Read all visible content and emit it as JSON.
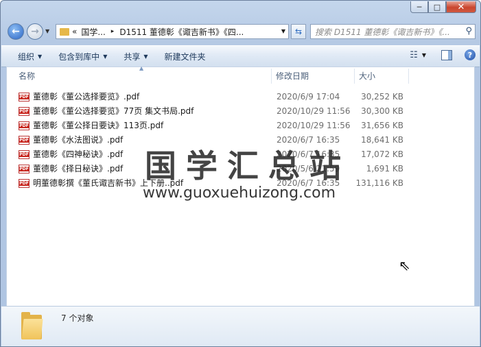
{
  "window": {
    "minimize_glyph": "─",
    "maximize_glyph": "□",
    "close_glyph": "✕"
  },
  "address": {
    "overflow": "«",
    "crumb_1": "国学...",
    "separator": "▸",
    "crumb_2": "D1511 董德彰《诹吉新书》《四..."
  },
  "search": {
    "placeholder": "搜索 D1511 董德彰《诹吉新书》《..."
  },
  "toolbar": {
    "organize": "组织",
    "include_in_library": "包含到库中",
    "share": "共享",
    "new_folder": "新建文件夹"
  },
  "columns": {
    "name": "名称",
    "date": "修改日期",
    "size": "大小"
  },
  "files": [
    {
      "name": "董德彰《董公选择要览》.pdf",
      "date": "2020/6/9 17:04",
      "size": "30,252 KB"
    },
    {
      "name": "董德彰《董公选择要览》77页 集文书局.pdf",
      "date": "2020/10/29 11:56",
      "size": "30,300 KB"
    },
    {
      "name": "董德彰《董公择日要诀》113页.pdf",
      "date": "2020/10/29 11:56",
      "size": "31,656 KB"
    },
    {
      "name": "董德彰《水法图说》.pdf",
      "date": "2020/6/7 16:35",
      "size": "18,641 KB"
    },
    {
      "name": "董德彰《四神秘诀》.pdf",
      "date": "2020/6/7 16:35",
      "size": "17,072 KB"
    },
    {
      "name": "董德彰《择日秘诀》.pdf",
      "date": "2020/5/6 21:59",
      "size": "1,691 KB"
    },
    {
      "name": "明董德彰撰《董氏诹吉新书》上下册..pdf",
      "date": "2020/6/7 16:35",
      "size": "131,116 KB"
    }
  ],
  "watermark": {
    "chinese": "国学汇总站",
    "url": "www.guoxuehuizong.com"
  },
  "status": {
    "item_count": "7 个对象"
  },
  "icons": {
    "file_type": "pdf-icon",
    "pdf_badge": "PDF"
  }
}
